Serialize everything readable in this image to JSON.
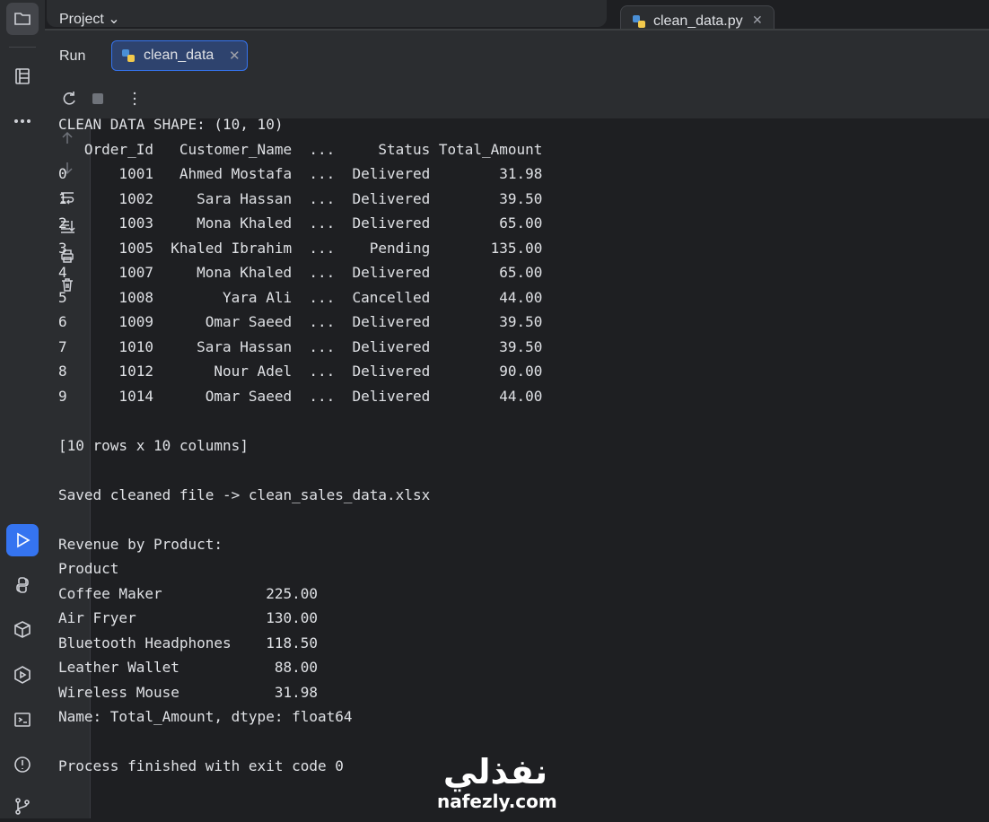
{
  "top": {
    "project_label": "Project ⌄",
    "editor_tab": "clean_data.py"
  },
  "run_window": {
    "title": "Run",
    "tab_label": "clean_data"
  },
  "console_lines": [
    "CLEAN DATA SHAPE: (10, 10)",
    "   Order_Id   Customer_Name  ...     Status Total_Amount",
    "0      1001   Ahmed Mostafa  ...  Delivered        31.98",
    "1      1002     Sara Hassan  ...  Delivered        39.50",
    "2      1003     Mona Khaled  ...  Delivered        65.00",
    "3      1005  Khaled Ibrahim  ...    Pending       135.00",
    "4      1007     Mona Khaled  ...  Delivered        65.00",
    "5      1008        Yara Ali  ...  Cancelled        44.00",
    "6      1009      Omar Saeed  ...  Delivered        39.50",
    "7      1010     Sara Hassan  ...  Delivered        39.50",
    "8      1012       Nour Adel  ...  Delivered        90.00",
    "9      1014      Omar Saeed  ...  Delivered        44.00",
    "",
    "[10 rows x 10 columns]",
    "",
    "Saved cleaned file -> clean_sales_data.xlsx",
    "",
    "Revenue by Product:",
    "Product",
    "Coffee Maker            225.00",
    "Air Fryer               130.00",
    "Bluetooth Headphones    118.50",
    "Leather Wallet           88.00",
    "Wireless Mouse           31.98",
    "Name: Total_Amount, dtype: float64",
    "",
    "Process finished with exit code 0"
  ],
  "watermark": {
    "arabic": "نفذلي",
    "latin": "nafezly.com"
  },
  "colors": {
    "accent": "#3574f0",
    "background": "#1e1f22",
    "panel": "#2b2d30"
  }
}
